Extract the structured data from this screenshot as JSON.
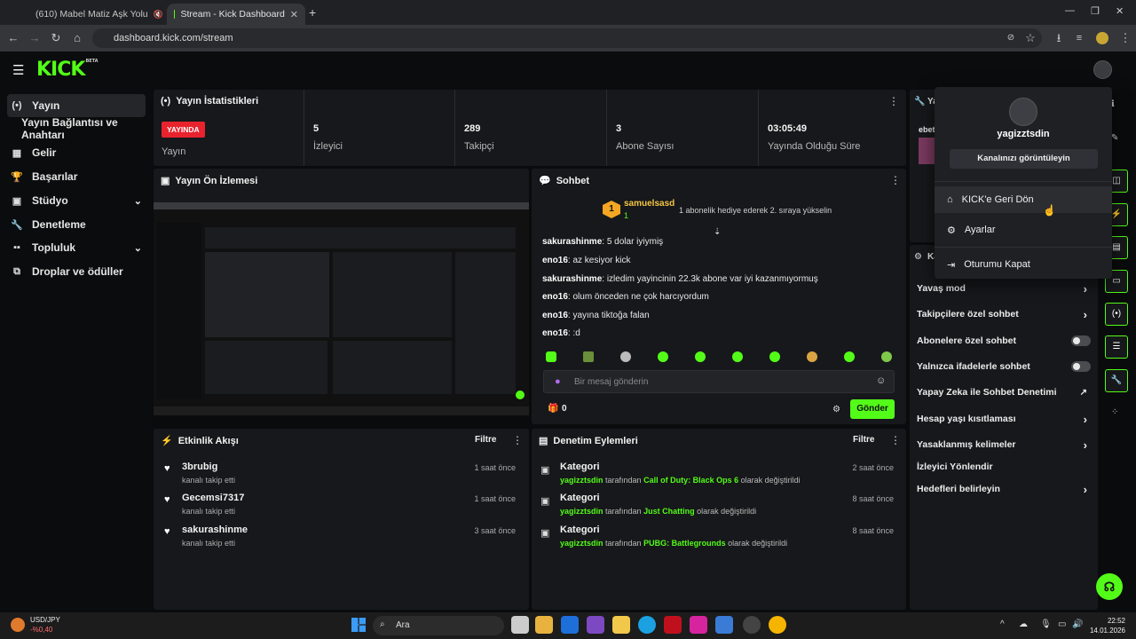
{
  "browser": {
    "tabs": [
      {
        "title": "(610) Mabel Matiz Aşk Yolu",
        "active": false
      },
      {
        "title": "Stream - Kick Dashboard",
        "active": true
      }
    ],
    "url": "dashboard.kick.com/stream"
  },
  "app": {
    "logo": "KICK",
    "logo_sup": "BETA"
  },
  "sidebar": {
    "items": [
      {
        "label": "Yayın",
        "icon": "broadcast-icon"
      },
      {
        "label": "Yayın Bağlantısı ve Anahtarı",
        "icon": ""
      },
      {
        "label": "Gelir",
        "icon": "revenue-icon"
      },
      {
        "label": "Başarılar",
        "icon": "trophy-icon"
      },
      {
        "label": "Stüdyo",
        "icon": "studio-icon"
      },
      {
        "label": "Denetleme",
        "icon": "wrench-icon"
      },
      {
        "label": "Topluluk",
        "icon": "community-icon"
      },
      {
        "label": "Droplar ve ödüller",
        "icon": "gift-icon"
      }
    ]
  },
  "stats": {
    "title": "Yayın İstatistikleri",
    "live_badge": "YAYINDA",
    "items": [
      {
        "value": "",
        "label": "Yayın"
      },
      {
        "value": "5",
        "label": "İzleyici"
      },
      {
        "value": "289",
        "label": "Takipçi"
      },
      {
        "value": "3",
        "label": "Abone Sayısı"
      },
      {
        "value": "03:05:49",
        "label": "Yayında Olduğu Süre"
      }
    ]
  },
  "preview": {
    "title": "Yayın Ön İzlemesi"
  },
  "chat": {
    "title": "Sohbet",
    "pinned_user": "samuelsasd",
    "pinned_rank": "1",
    "pinned_badge": "1",
    "pinned_text": "1 abonelik hediye ederek 2. sıraya yükselin",
    "messages": [
      {
        "user": "sakurashinme",
        "text": "5 dolar iyiymiş",
        "color": "#c48bfc"
      },
      {
        "user": "eno16",
        "text": "az kesiyor kick",
        "color": "#ffffff"
      },
      {
        "user": "sakurashinme",
        "text": "izledim yayincinin 22.3k abone var iyi kazanmıyormuş",
        "color": "#c48bfc"
      },
      {
        "user": "eno16",
        "text": "olum önceden ne çok harcıyordum",
        "color": "#ffffff"
      },
      {
        "user": "eno16",
        "text": "yayına tiktoğa falan",
        "color": "#ffffff"
      },
      {
        "user": "eno16",
        "text": ":d",
        "color": "#ffffff"
      }
    ],
    "input_placeholder": "Bir mesaj gönderin",
    "gift_count": "0",
    "send_label": "Gönder"
  },
  "events": {
    "title": "Etkinlik Akışı",
    "filter": "Filtre",
    "rows": [
      {
        "name": "3brubig",
        "sub": "kanalı takip etti",
        "time": "1 saat önce"
      },
      {
        "name": "Gecemsi7317",
        "sub": "kanalı takip etti",
        "time": "1 saat önce"
      },
      {
        "name": "sakurashinme",
        "sub": "kanalı takip etti",
        "time": "3 saat önce"
      }
    ]
  },
  "moderation": {
    "title": "Denetim Eylemleri",
    "filter": "Filtre",
    "rows": [
      {
        "name": "Kategori",
        "user": "yagizztsdin",
        "by": "tarafından",
        "game": "Call of Duty: Black Ops 6",
        "tail": "olarak değiştirildi",
        "time": "2 saat önce"
      },
      {
        "name": "Kategori",
        "user": "yagizztsdin",
        "by": "tarafından",
        "game": "Just Chatting",
        "tail": "olarak değiştirildi",
        "time": "8 saat önce"
      },
      {
        "name": "Kategori",
        "user": "yagizztsdin",
        "by": "tarafından",
        "game": "PUBG: Battlegrounds",
        "tail": "olarak değiştirildi",
        "time": "8 saat önce"
      }
    ]
  },
  "right_panel": {
    "top_title": "Ya",
    "top_name": "ebet",
    "second_title": "Ka",
    "items": [
      {
        "label": "Yavaş mod",
        "control": "chevron"
      },
      {
        "label": "Takipçilere özel sohbet",
        "control": "chevron"
      },
      {
        "label": "Abonelere özel sohbet",
        "control": "toggle"
      },
      {
        "label": "Yalnızca ifadelerle sohbet",
        "control": "toggle"
      },
      {
        "label": "Yapay Zeka ile Sohbet Denetimi",
        "control": "external"
      },
      {
        "label": "Hesap yaşı kısıtlaması",
        "control": "chevron"
      },
      {
        "label": "Yasaklanmış kelimeler",
        "control": "chevron"
      },
      {
        "label": "İzleyici Yönlendir",
        "control": "none"
      },
      {
        "label": "Hedefleri belirleyin",
        "control": "chevron"
      }
    ]
  },
  "dropdown": {
    "username": "yagizztsdin",
    "view_channel": "Kanalınızı görüntüleyin",
    "items": [
      {
        "label": "KICK'e Geri Dön",
        "icon": "home-icon"
      },
      {
        "label": "Ayarlar",
        "icon": "gear-icon"
      },
      {
        "label": "Oturumu Kapat",
        "icon": "logout-icon"
      }
    ]
  },
  "taskbar": {
    "ticker": "USD/JPY",
    "ticker_change": "-%0,40",
    "search": "Ara",
    "time": "22:52",
    "date": "14.01.2026"
  },
  "colors": {
    "accent": "#53fc18",
    "live": "#e8232e",
    "panel": "#17181b"
  }
}
